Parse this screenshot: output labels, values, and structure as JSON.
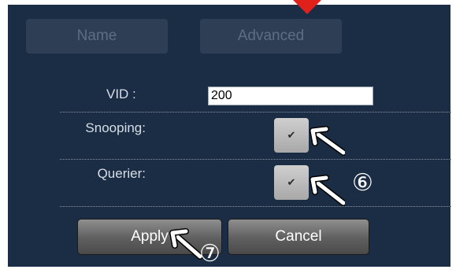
{
  "tabs": [
    {
      "label": "Name"
    },
    {
      "label": "Advanced"
    }
  ],
  "form": {
    "vid_label": "VID :",
    "vid_value": "200",
    "snooping_label": "Snooping:",
    "snooping_checked": true,
    "querier_label": "Querier:",
    "querier_checked": true
  },
  "buttons": {
    "apply_label": "Apply",
    "cancel_label": "Cancel"
  },
  "annotations": {
    "marker_6": "⑥",
    "marker_7": "⑦",
    "check_glyph": "✔"
  },
  "colors": {
    "panel_bg": "#1b2d44",
    "annotation_red": "#e0201b"
  }
}
